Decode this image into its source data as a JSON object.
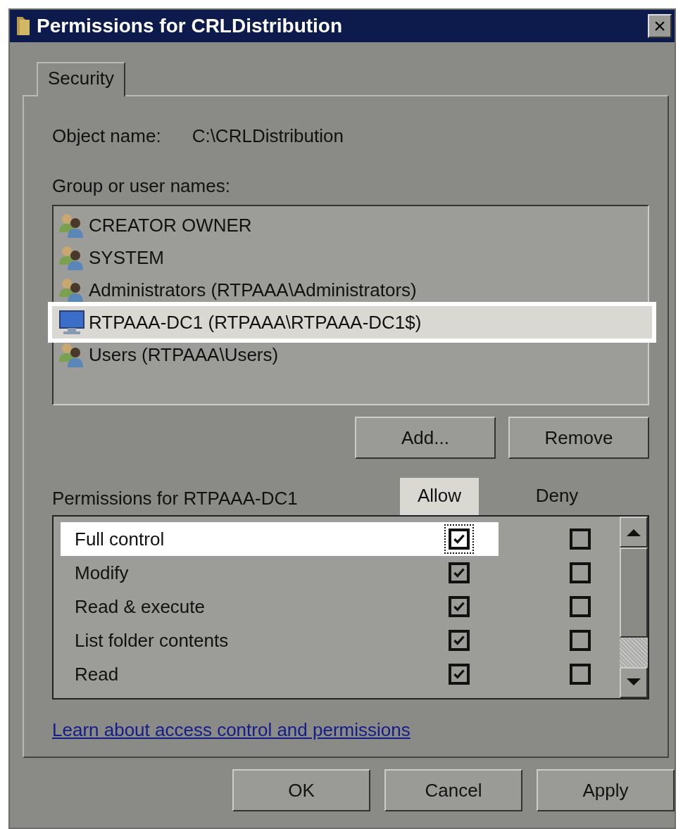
{
  "window": {
    "title": "Permissions for CRLDistribution",
    "close": "×"
  },
  "tabs": [
    {
      "label": "Security"
    }
  ],
  "object_name": {
    "label": "Object name:",
    "value": "C:\\CRLDistribution"
  },
  "group_label": "Group or user names:",
  "users": [
    {
      "name": "CREATOR OWNER",
      "kind": "group",
      "selected": false
    },
    {
      "name": "SYSTEM",
      "kind": "group",
      "selected": false
    },
    {
      "name": "Administrators (RTPAAA\\Administrators)",
      "kind": "group",
      "selected": false
    },
    {
      "name": "RTPAAA-DC1 (RTPAAA\\RTPAAA-DC1$)",
      "kind": "computer",
      "selected": true
    },
    {
      "name": "Users (RTPAAA\\Users)",
      "kind": "group",
      "selected": false
    }
  ],
  "user_buttons": [
    "Add...",
    "Remove"
  ],
  "permissions_label": "Permissions for RTPAAA-DC1",
  "columns": [
    {
      "label": "Allow",
      "highlighted": true
    },
    {
      "label": "Deny",
      "highlighted": false
    }
  ],
  "permissions": [
    {
      "name": "Full control",
      "allow": true,
      "deny": false,
      "highlighted": true
    },
    {
      "name": "Modify",
      "allow": true,
      "deny": false,
      "highlighted": false
    },
    {
      "name": "Read & execute",
      "allow": true,
      "deny": false,
      "highlighted": false
    },
    {
      "name": "List folder contents",
      "allow": true,
      "deny": false,
      "highlighted": false
    },
    {
      "name": "Read",
      "allow": true,
      "deny": false,
      "highlighted": false
    }
  ],
  "link": "Learn about access control and permissions",
  "buttons": [
    "OK",
    "Cancel",
    "Apply"
  ]
}
